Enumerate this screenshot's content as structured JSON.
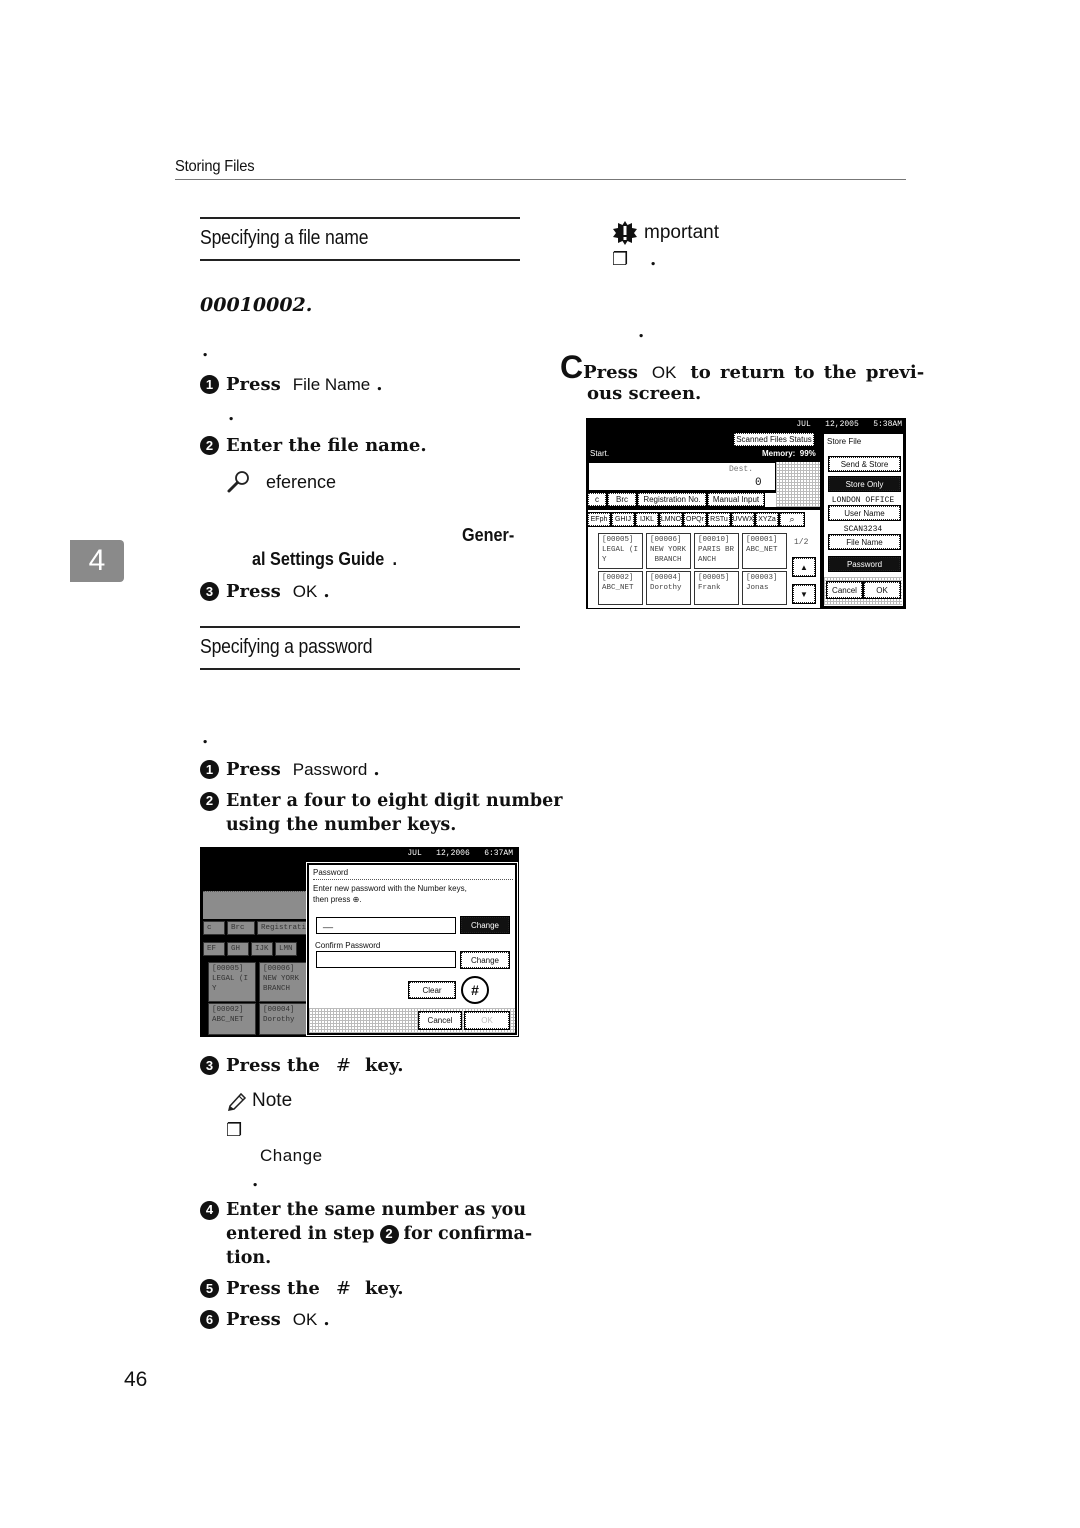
{
  "header": {
    "running_head": "Storing Files"
  },
  "chapter_tab": "4",
  "page_number": "46",
  "left": {
    "file_name_section": {
      "title": "Specifying a file name",
      "example_number": "00010002.",
      "lead_dot": ".",
      "steps": [
        {
          "num": "1",
          "verb": "Press",
          "key": "File Name",
          "end": "."
        },
        {
          "num": "2",
          "text": "Enter the file name."
        },
        {
          "num": "3",
          "verb": "Press",
          "key": "OK",
          "end": "."
        }
      ],
      "after_step1_dot": ".",
      "reference": {
        "icon": "magnifier-icon",
        "label": "eference",
        "guide_part1": "Gener-",
        "guide_part2": "al Settings Guide",
        "guide_end": "."
      }
    },
    "password_section": {
      "title": "Specifying a password",
      "lead_dot": ".",
      "steps": [
        {
          "num": "1",
          "verb": "Press",
          "key": "Password",
          "end": "."
        },
        {
          "num": "2",
          "line1": "Enter a four to eight digit number",
          "line2": "using the number keys."
        },
        {
          "num": "3",
          "verb": "Press the",
          "key": "#",
          "end": "key."
        },
        {
          "num": "4",
          "line1": "Enter the same number as you",
          "line2a": "entered in step",
          "ref": "2",
          "line2b": "for confirma-",
          "line3": "tion."
        },
        {
          "num": "5",
          "verb": "Press the",
          "key": "#",
          "end": "key."
        },
        {
          "num": "6",
          "verb": "Press",
          "key": "OK",
          "end": "."
        }
      ],
      "note": {
        "icon": "pencil-icon",
        "label": "Note",
        "checkbox": "❐",
        "key": "Change",
        "end_dot": "."
      }
    }
  },
  "password_screen": {
    "datetime": "JUL   12,2006   6:37AM",
    "dialog_title": "Password",
    "instruction_line1": "Enter new password with the Number keys,",
    "instruction_line2": "then press ⊕.",
    "input_value": "__",
    "change_label": "Change",
    "confirm_label": "Confirm Password",
    "clear_label": "Clear",
    "hash_label": "#",
    "cancel_label": "Cancel",
    "ok_label": "OK",
    "bg_tabs": [
      "c",
      "Brc",
      "Registratio"
    ],
    "bg_keys": [
      "EF",
      "GH",
      "IJK",
      "LMN"
    ],
    "bg_cells": [
      {
        "code": "[00005]",
        "line1": "LEGAL (I",
        "line2": "Y"
      },
      {
        "code": "[00006]",
        "line1": "NEW YORK",
        "line2": "BRANCH"
      },
      {
        "code": "[00002]",
        "line1": "ABC_NET",
        "line2": ""
      },
      {
        "code": "[00004]",
        "line1": "Dorothy",
        "line2": ""
      }
    ]
  },
  "right": {
    "important": {
      "icon": "important-icon",
      "label": "mportant",
      "checkbox": "❐",
      "dot": "."
    },
    "stray_dot": ".",
    "step_c": {
      "letter": "C",
      "verb": "Press",
      "key": "OK",
      "rest_line1": "to return to the previ-",
      "rest_line2": "ous screen."
    }
  },
  "store_screen": {
    "datetime": "JUL   12,2005   5:38AM",
    "scanned_files_status": "Scanned Files Status",
    "start_label": "Start.",
    "memory": "Memory:  99%",
    "dest_label": "Dest.",
    "dest_count": "0",
    "tabs": [
      "c",
      "Brc",
      "Registration No.",
      "Manual Input"
    ],
    "keys": [
      "EFph",
      "GHIJ",
      "IJKL",
      "LMNO",
      "OPQr",
      "RSTu",
      "UVWX",
      "XYZa"
    ],
    "search_icon": "search-icon",
    "page_indicator": "1/2",
    "cells": [
      {
        "code": "[00005]",
        "line1": "LEGAL (I",
        "line2": "Y"
      },
      {
        "code": "[00006]",
        "line1": "NEW YORK",
        "line2": " BRANCH"
      },
      {
        "code": "[00010]",
        "line1": "PARIS BR",
        "line2": "ANCH"
      },
      {
        "code": "[00001]",
        "line1": "ABC_NET",
        "line2": ""
      },
      {
        "code": "[00002]",
        "line1": "ABC_NET",
        "line2": ""
      },
      {
        "code": "[00004]",
        "line1": "Dorothy",
        "line2": ""
      },
      {
        "code": "[00005]",
        "line1": "Frank",
        "line2": ""
      },
      {
        "code": "[00003]",
        "line1": "Jonas",
        "line2": ""
      }
    ],
    "panel": {
      "title": "Store File",
      "send_store": "Send & Store",
      "store_only": "Store Only",
      "user_value": "LONDON OFFICE",
      "user_name": "User Name",
      "file_value": "SCAN3234",
      "file_name": "File Name",
      "password": "Password",
      "cancel": "Cancel",
      "ok": "OK"
    }
  }
}
